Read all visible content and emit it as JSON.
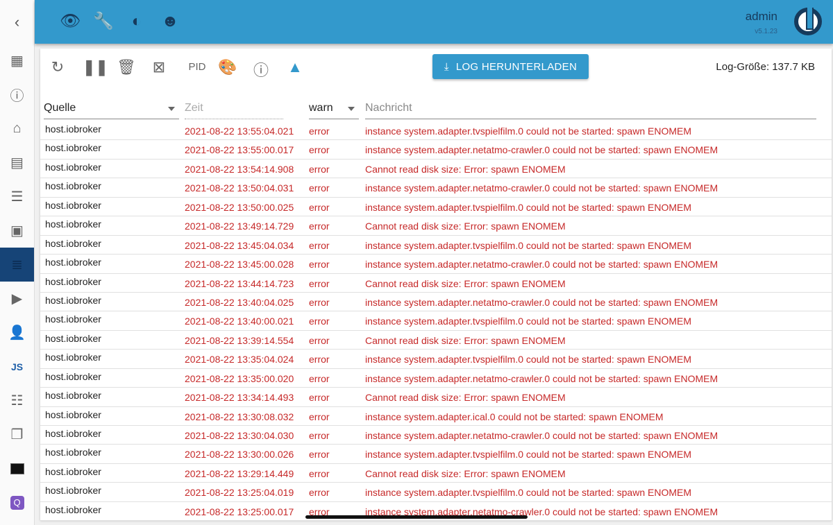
{
  "header": {
    "user": "admin",
    "version": "v5.1.23"
  },
  "toolbar": {
    "pid_label": "PID",
    "download_label": "LOG HERUNTERLADEN",
    "log_size": "Log-Größe: 137.7 KB"
  },
  "filters": {
    "source": "Quelle",
    "time_placeholder": "Zeit",
    "level": "warn",
    "message_placeholder": "Nachricht"
  },
  "rows": [
    [
      "host.iobroker",
      "2021-08-22 13:55:04.021",
      "error",
      "instance system.adapter.tvspielfilm.0 could not be started: spawn ENOMEM"
    ],
    [
      "host.iobroker",
      "2021-08-22 13:55:00.017",
      "error",
      "instance system.adapter.netatmo-crawler.0 could not be started: spawn ENOMEM"
    ],
    [
      "host.iobroker",
      "2021-08-22 13:54:14.908",
      "error",
      "Cannot read disk size: Error: spawn ENOMEM"
    ],
    [
      "host.iobroker",
      "2021-08-22 13:50:04.031",
      "error",
      "instance system.adapter.netatmo-crawler.0 could not be started: spawn ENOMEM"
    ],
    [
      "host.iobroker",
      "2021-08-22 13:50:00.025",
      "error",
      "instance system.adapter.tvspielfilm.0 could not be started: spawn ENOMEM"
    ],
    [
      "host.iobroker",
      "2021-08-22 13:49:14.729",
      "error",
      "Cannot read disk size: Error: spawn ENOMEM"
    ],
    [
      "host.iobroker",
      "2021-08-22 13:45:04.034",
      "error",
      "instance system.adapter.tvspielfilm.0 could not be started: spawn ENOMEM"
    ],
    [
      "host.iobroker",
      "2021-08-22 13:45:00.028",
      "error",
      "instance system.adapter.netatmo-crawler.0 could not be started: spawn ENOMEM"
    ],
    [
      "host.iobroker",
      "2021-08-22 13:44:14.723",
      "error",
      "Cannot read disk size: Error: spawn ENOMEM"
    ],
    [
      "host.iobroker",
      "2021-08-22 13:40:04.025",
      "error",
      "instance system.adapter.netatmo-crawler.0 could not be started: spawn ENOMEM"
    ],
    [
      "host.iobroker",
      "2021-08-22 13:40:00.021",
      "error",
      "instance system.adapter.tvspielfilm.0 could not be started: spawn ENOMEM"
    ],
    [
      "host.iobroker",
      "2021-08-22 13:39:14.554",
      "error",
      "Cannot read disk size: Error: spawn ENOMEM"
    ],
    [
      "host.iobroker",
      "2021-08-22 13:35:04.024",
      "error",
      "instance system.adapter.tvspielfilm.0 could not be started: spawn ENOMEM"
    ],
    [
      "host.iobroker",
      "2021-08-22 13:35:00.020",
      "error",
      "instance system.adapter.netatmo-crawler.0 could not be started: spawn ENOMEM"
    ],
    [
      "host.iobroker",
      "2021-08-22 13:34:14.493",
      "error",
      "Cannot read disk size: Error: spawn ENOMEM"
    ],
    [
      "host.iobroker",
      "2021-08-22 13:30:08.032",
      "error",
      "instance system.adapter.ical.0 could not be started: spawn ENOMEM"
    ],
    [
      "host.iobroker",
      "2021-08-22 13:30:04.030",
      "error",
      "instance system.adapter.netatmo-crawler.0 could not be started: spawn ENOMEM"
    ],
    [
      "host.iobroker",
      "2021-08-22 13:30:00.026",
      "error",
      "instance system.adapter.tvspielfilm.0 could not be started: spawn ENOMEM"
    ],
    [
      "host.iobroker",
      "2021-08-22 13:29:14.449",
      "error",
      "Cannot read disk size: Error: spawn ENOMEM"
    ],
    [
      "host.iobroker",
      "2021-08-22 13:25:04.019",
      "error",
      "instance system.adapter.tvspielfilm.0 could not be started: spawn ENOMEM"
    ],
    [
      "host.iobroker",
      "2021-08-22 13:25:00.017",
      "error",
      "instance system.adapter.netatmo-crawler.0 could not be started: spawn ENOMEM"
    ]
  ]
}
